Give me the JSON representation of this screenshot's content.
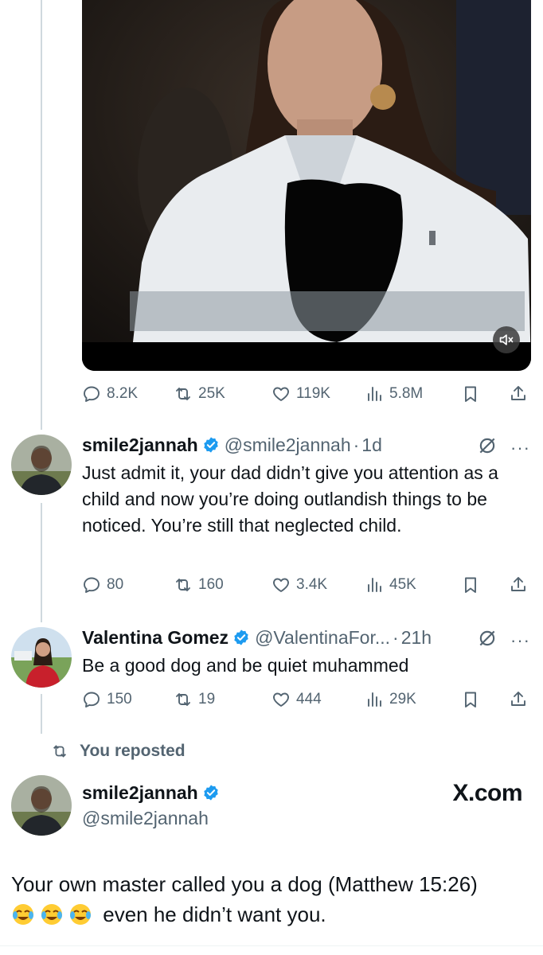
{
  "video": {
    "mute_icon": "speaker-muted-icon"
  },
  "quoted_post_actions": {
    "replies": "8.2K",
    "reposts": "25K",
    "likes": "119K",
    "views": "5.8M"
  },
  "reply_1": {
    "display_name": "smile2jannah",
    "handle": "@smile2jannah",
    "separator": "·",
    "time": "1d",
    "text": "Just admit it, your dad didn’t give you attention as a child and now you’re doing outlandish things to be noticed. You’re still  that neglected child.",
    "replies": "80",
    "reposts": "160",
    "likes": "3.4K",
    "views": "45K"
  },
  "reply_2": {
    "display_name": "Valentina Gomez",
    "handle": "@ValentinaFor...",
    "separator": "·",
    "time": "21h",
    "text": "Be a good dog and be quiet muhammed",
    "replies": "150",
    "reposts": "19",
    "likes": "444",
    "views": "29K"
  },
  "repost_banner": {
    "label": "You reposted"
  },
  "main_post": {
    "display_name": "smile2jannah",
    "handle": "@smile2jannah",
    "watermark": "X.com",
    "text_line1": "Your own master called you a dog (Matthew 15:26)",
    "text_line2": "even he didn’t want you.",
    "emoji": [
      "face-with-tears-of-joy",
      "face-with-tears-of-joy",
      "face-with-tears-of-joy"
    ]
  },
  "colors": {
    "text": "#0f1419",
    "secondary": "#536471",
    "verified": "#1d9bf0",
    "thread_line": "#cfd9de"
  }
}
